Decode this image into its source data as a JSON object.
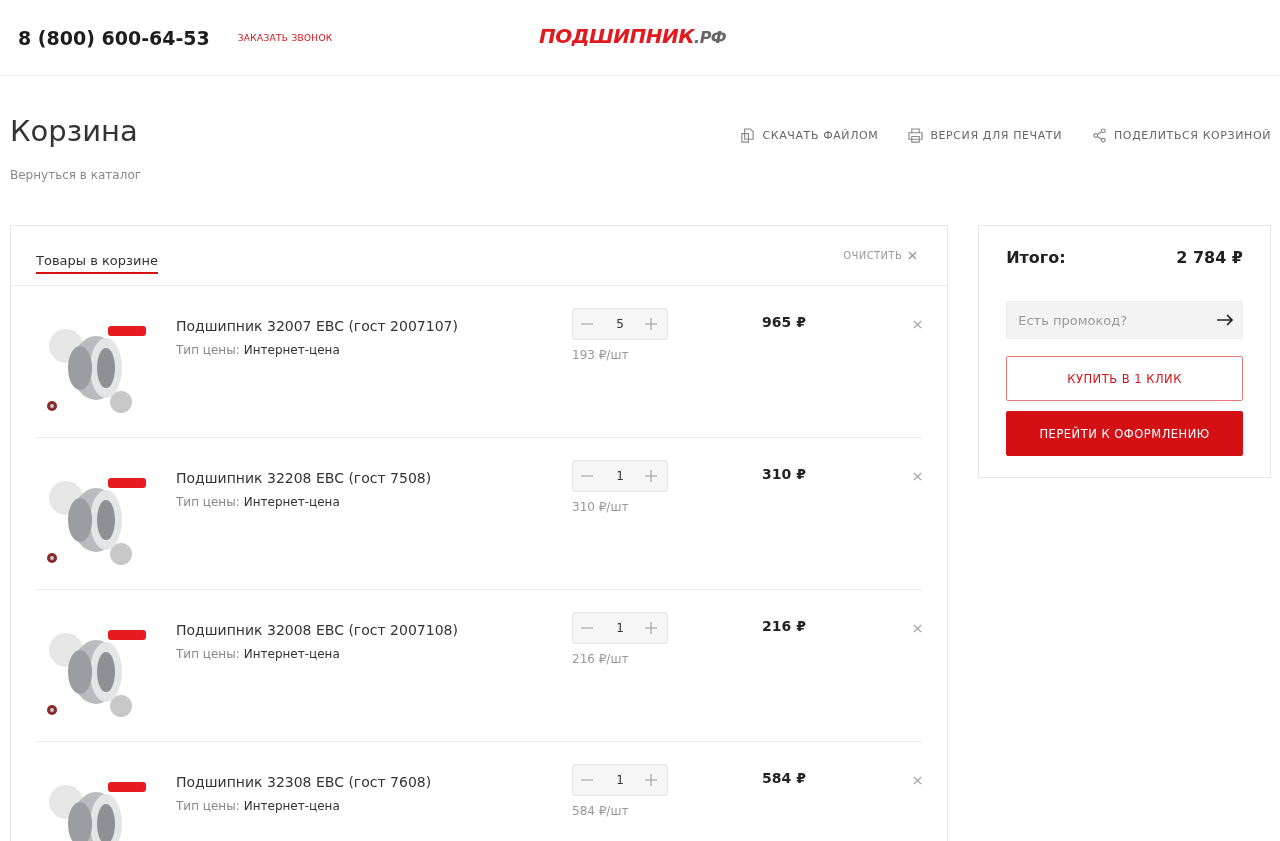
{
  "header": {
    "phone": "8 (800) 600-64-53",
    "callback": "ЗАКАЗАТЬ ЗВОНОК",
    "logo": {
      "name": "ПОДШИПНИК",
      "domain": ".РФ"
    }
  },
  "page": {
    "title": "Корзина",
    "back_link": "Вернуться в каталог",
    "actions": [
      {
        "kind": "download",
        "label": "СКАЧАТЬ ФАЙЛОМ"
      },
      {
        "kind": "print",
        "label": "ВЕРСИЯ ДЛЯ ПЕЧАТИ"
      },
      {
        "kind": "share",
        "label": "ПОДЕЛИТЬСЯ КОРЗИНОЙ"
      }
    ]
  },
  "cart": {
    "tab": {
      "label": "Товары в корзине",
      "selected": true
    },
    "clear": "ОЧИСТИТЬ",
    "items": [
      {
        "name": "Подшипник 32007 EBC (гост 2007107)",
        "price_type_label": "Тип цены:",
        "price_type": "Интернет-цена",
        "quantity": "5",
        "unit_price": "193 ₽/шт",
        "total": "965 ₽"
      },
      {
        "name": "Подшипник 32208 EBC (гост 7508)",
        "price_type_label": "Тип цены:",
        "price_type": "Интернет-цена",
        "quantity": "1",
        "unit_price": "310 ₽/шт",
        "total": "310 ₽"
      },
      {
        "name": "Подшипник 32008 EBC (гост 2007108)",
        "price_type_label": "Тип цены:",
        "price_type": "Интернет-цена",
        "quantity": "1",
        "unit_price": "216 ₽/шт",
        "total": "216 ₽"
      },
      {
        "name": "Подшипник 32308 EBC (гост 7608)",
        "price_type_label": "Тип цены:",
        "price_type": "Интернет-цена",
        "quantity": "1",
        "unit_price": "584 ₽/шт",
        "total": "584 ₽"
      }
    ]
  },
  "summary": {
    "total_label": "Итого:",
    "total": "2 784 ₽",
    "promo": {
      "placeholder": "Есть промокод?"
    },
    "buttons": [
      {
        "kind": "secondary",
        "label": "КУПИТЬ В 1 КЛИК"
      },
      {
        "kind": "primary",
        "label": "ПЕРЕЙТИ К ОФОРМЛЕНИЮ"
      }
    ]
  }
}
